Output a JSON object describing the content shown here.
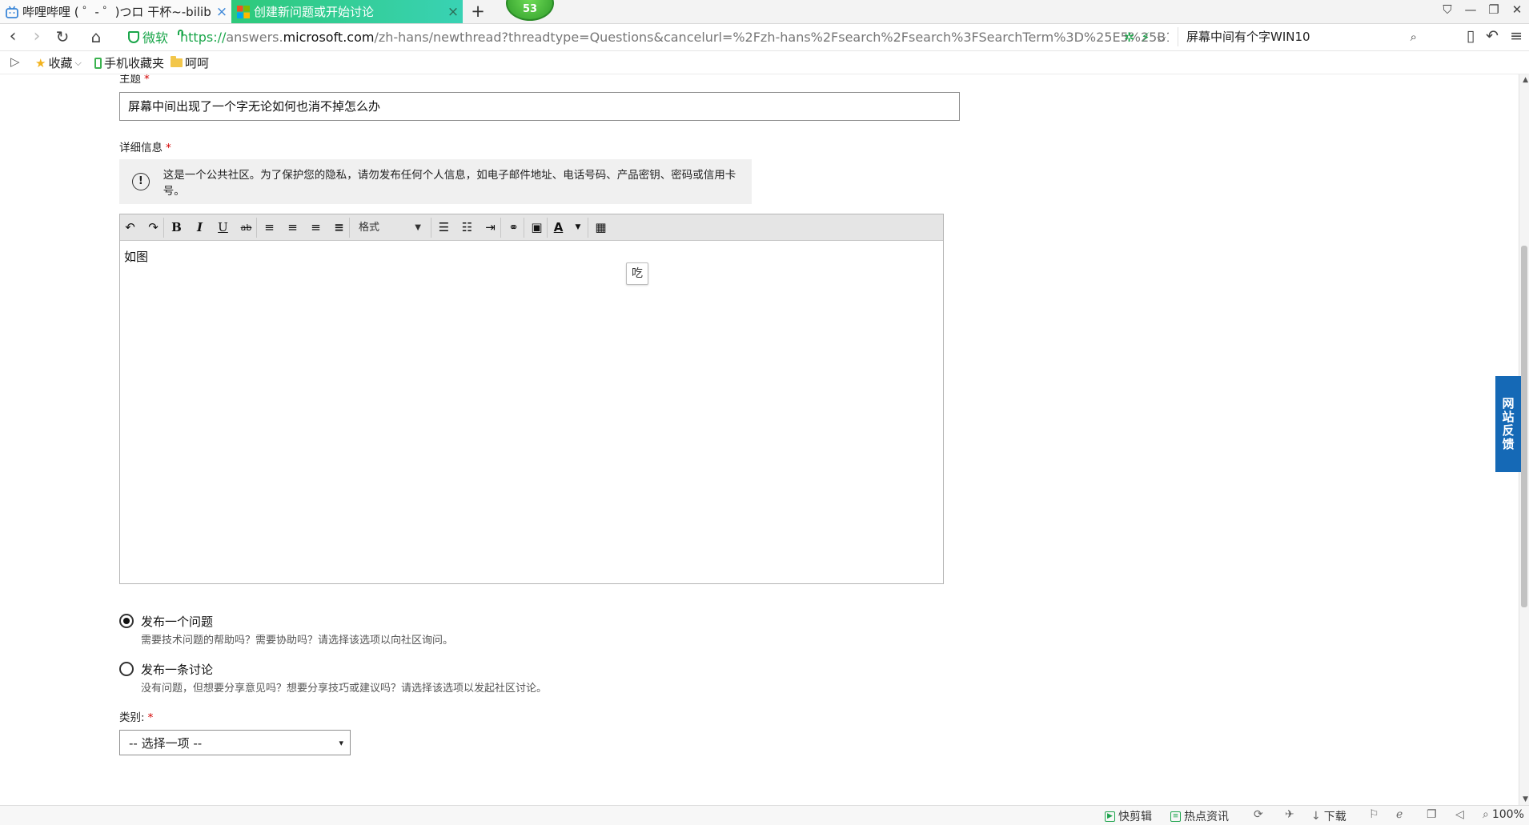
{
  "tabs": [
    {
      "title": "哔哩哔哩 ( ゜- ゜)つロ 干杯~-bilibili",
      "close": "×"
    },
    {
      "title": "创建新问题或开始讨论",
      "close": "×"
    }
  ],
  "new_tab": "+",
  "notification_count": "53",
  "window_controls": {
    "skin": "⛉",
    "minimize": "—",
    "restore": "❐",
    "close": "✕"
  },
  "nav": {
    "back": "‹",
    "forward": "›",
    "reload": "↻",
    "home": "⌂"
  },
  "address": {
    "site_label": "微软",
    "scheme": "https://",
    "subdomain": "answers.",
    "domain": "microsoft.com",
    "path": "/zh-hans/newthread?threadtype=Questions&cancelurl=%2Fzh-hans%2Fsearch%2Fsearch%3FSearchTerm%3D%25E5%25B1%25",
    "icons": {
      "extension": "✲",
      "speed": "⚡",
      "dropdown": "⌵"
    }
  },
  "search": {
    "value": "屏幕中间有个字WIN10",
    "icon": "⌕"
  },
  "right_nav": {
    "reader": "▯",
    "undo": "↶",
    "menu": "≡"
  },
  "bookmarks": {
    "toggle": "▷",
    "items": [
      {
        "label": "收藏",
        "suffix": "⌵"
      },
      {
        "label": "手机收藏夹"
      },
      {
        "label": "呵呵"
      }
    ]
  },
  "form": {
    "subject_label": "主题",
    "required_mark": "*",
    "subject_value": "屏幕中间出现了一个字无论如何也消不掉怎么办",
    "details_label": "详细信息",
    "privacy_icon": "!",
    "privacy_notice": "这是一个公共社区。为了保护您的隐私，请勿发布任何个人信息，如电子邮件地址、电话号码、产品密钥、密码或信用卡号。",
    "toolbar": {
      "undo": "↶",
      "redo": "↷",
      "bold": "B",
      "italic": "I",
      "underline": "U",
      "strike": "ab",
      "align_left": "≡",
      "align_center": "≡",
      "align_right": "≡",
      "justify": "≡",
      "format_label": "格式",
      "format_caret": "▼",
      "bullet_list": "☰",
      "numbered_list": "☷",
      "indent": "⇥",
      "link": "⚭",
      "image": "▣",
      "font_color": "A",
      "font_color_caret": "▼",
      "table": "▦"
    },
    "editor_content": "如图",
    "ime_indicator": "吃",
    "post_question_title": "发布一个问题",
    "post_question_desc": "需要技术问题的帮助吗？需要协助吗？请选择该选项以向社区询问。",
    "post_discussion_title": "发布一条讨论",
    "post_discussion_desc": "没有问题，但想要分享意见吗？想要分享技巧或建议吗？请选择该选项以发起社区讨论。",
    "category_label": "类别:",
    "category_select": "-- 选择一项 --",
    "category_caret": "▾"
  },
  "feedback_tab": "网站反馈",
  "status_bar": {
    "quick_clip": "快剪辑",
    "hot_news": "热点资讯",
    "download": "下载",
    "zoom": "100%",
    "icons": {
      "clip": "✂",
      "news": "☷",
      "refresh": "⟳",
      "pin": "✈",
      "download": "↓",
      "flag": "⚐",
      "ie": "ℯ",
      "window": "❐",
      "sound": "◁",
      "zoom": "⌕"
    }
  }
}
